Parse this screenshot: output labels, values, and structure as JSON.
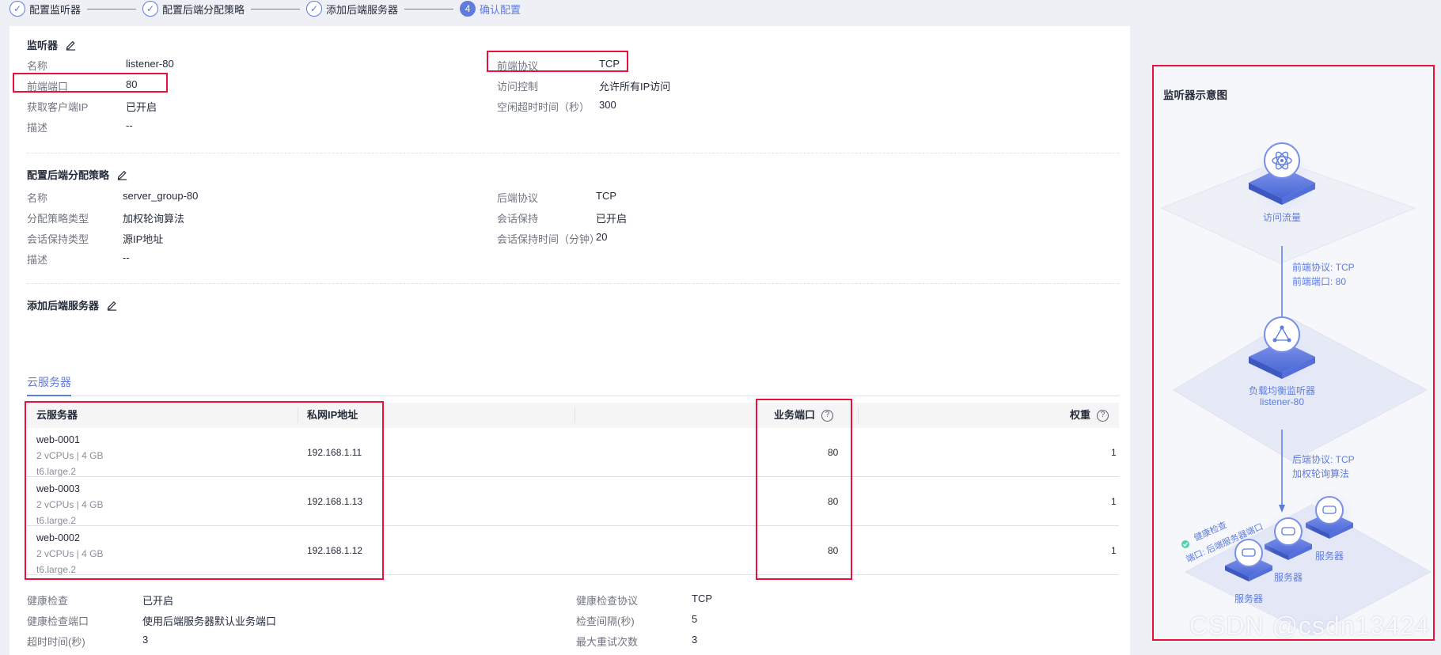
{
  "steps": [
    {
      "label": "配置监听器",
      "state": "done"
    },
    {
      "label": "配置后端分配策略",
      "state": "done"
    },
    {
      "label": "添加后端服务器",
      "state": "done"
    },
    {
      "label": "确认配置",
      "state": "active",
      "number": "4"
    }
  ],
  "listener": {
    "title": "监听器",
    "name_k": "名称",
    "name_v": "listener-80",
    "frontend_protocol_k": "前端协议",
    "frontend_protocol_v": "TCP",
    "frontend_port_k": "前端端口",
    "frontend_port_v": "80",
    "access_control_k": "访问控制",
    "access_control_v": "允许所有IP访问",
    "client_ip_k": "获取客户端IP",
    "client_ip_v": "已开启",
    "idle_timeout_k": "空闲超时时间（秒）",
    "idle_timeout_v": "300",
    "desc_k": "描述",
    "desc_v": "--"
  },
  "backend_policy": {
    "title": "配置后端分配策略",
    "name_k": "名称",
    "name_v": "server_group-80",
    "backend_protocol_k": "后端协议",
    "backend_protocol_v": "TCP",
    "algorithm_k": "分配策略类型",
    "algorithm_v": "加权轮询算法",
    "sticky_k": "会话保持",
    "sticky_v": "已开启",
    "sticky_type_k": "会话保持类型",
    "sticky_type_v": "源IP地址",
    "sticky_time_k": "会话保持时间（分钟）",
    "sticky_time_v": "20",
    "desc_k": "描述",
    "desc_v": "--"
  },
  "backend_servers": {
    "title": "添加后端服务器",
    "tab": "云服务器",
    "columns": {
      "server": "云服务器",
      "ip": "私网IP地址",
      "port": "业务端口",
      "weight": "权重"
    },
    "rows": [
      {
        "name": "web-0001",
        "spec": "2 vCPUs | 4 GB",
        "flavor": "t6.large.2",
        "ip": "192.168.1.11",
        "port": "80",
        "weight": "1"
      },
      {
        "name": "web-0003",
        "spec": "2 vCPUs | 4 GB",
        "flavor": "t6.large.2",
        "ip": "192.168.1.13",
        "port": "80",
        "weight": "1"
      },
      {
        "name": "web-0002",
        "spec": "2 vCPUs | 4 GB",
        "flavor": "t6.large.2",
        "ip": "192.168.1.12",
        "port": "80",
        "weight": "1"
      }
    ]
  },
  "health_check": {
    "enabled_k": "健康检查",
    "enabled_v": "已开启",
    "protocol_k": "健康检查协议",
    "protocol_v": "TCP",
    "port_k": "健康检查端口",
    "port_v": "使用后端服务器默认业务端口",
    "interval_k": "检查间隔(秒)",
    "interval_v": "5",
    "timeout_k": "超时时间(秒)",
    "timeout_v": "3",
    "retries_k": "最大重试次数",
    "retries_v": "3"
  },
  "diagram": {
    "title": "监听器示意图",
    "traffic_label": "访问流量",
    "front_proto": "前端协议: TCP",
    "front_port": "前端端口: 80",
    "lb_label": "负载均衡监听器",
    "lb_name": "listener-80",
    "back_proto": "后端协议: TCP",
    "back_algo": "加权轮询算法",
    "health_label": "健康检查",
    "health_port": "端口: 后端服务器端口",
    "server_label": "服务器"
  },
  "watermark": "CSDN @csdn13424",
  "colors": {
    "accent": "#5e7ce0",
    "highlight": "#e8123c",
    "text": "#252b3a",
    "muted": "#71757f"
  }
}
